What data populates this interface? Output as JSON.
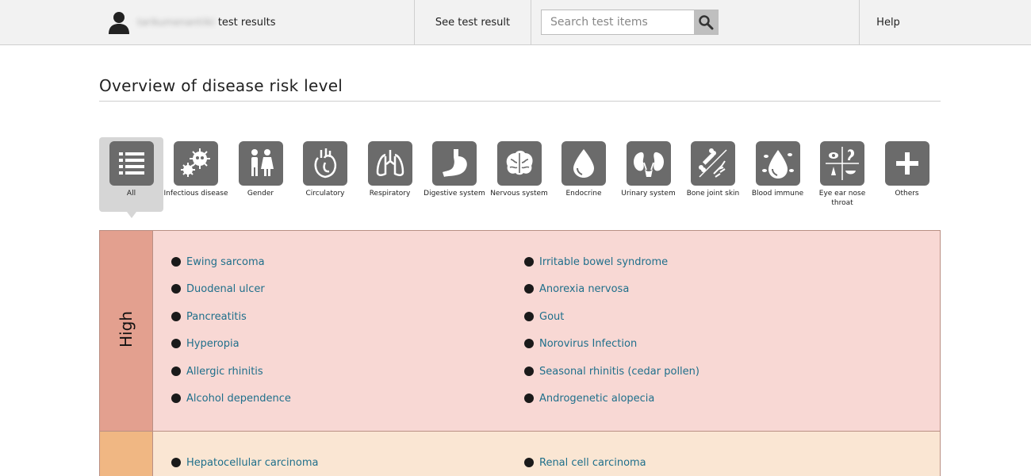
{
  "header": {
    "user_name": "tarikumenantiiki",
    "user_suffix": "test results",
    "see_result": "See test result",
    "search_placeholder": "Search test items",
    "help": "Help"
  },
  "page_title": "Overview of disease risk level",
  "categories": [
    {
      "label": "All",
      "icon": "list-icon",
      "active": true
    },
    {
      "label": "Infectious disease",
      "icon": "virus-icon"
    },
    {
      "label": "Gender",
      "icon": "gender-icon"
    },
    {
      "label": "Circulatory",
      "icon": "heart-icon"
    },
    {
      "label": "Respiratory",
      "icon": "lungs-icon"
    },
    {
      "label": "Digestive system",
      "icon": "stomach-icon"
    },
    {
      "label": "Nervous system",
      "icon": "brain-icon"
    },
    {
      "label": "Endocrine",
      "icon": "drop-icon"
    },
    {
      "label": "Urinary system",
      "icon": "kidney-icon"
    },
    {
      "label": "Bone joint skin",
      "icon": "bone-icon"
    },
    {
      "label": "Blood immune",
      "icon": "blood-drop-icon"
    },
    {
      "label": "Eye ear nose throat",
      "icon": "eye-ear-nose-icon"
    },
    {
      "label": "Others",
      "icon": "plus-icon"
    }
  ],
  "risk_levels": [
    {
      "label": "High",
      "color": "#e3a08f",
      "left": [
        "Ewing sarcoma",
        "Duodenal ulcer",
        "Pancreatitis",
        "Hyperopia",
        "Allergic rhinitis",
        "Alcohol dependence"
      ],
      "right": [
        "Irritable bowel syndrome",
        "Anorexia nervosa",
        "Gout",
        "Norovirus Infection",
        "Seasonal rhinitis (cedar pollen)",
        "Androgenetic alopecia"
      ]
    },
    {
      "label": "",
      "color": "#f0b783",
      "left": [
        "Hepatocellular carcinoma"
      ],
      "right": [
        "Renal cell carcinoma"
      ]
    }
  ],
  "colors": {
    "link": "#1f6f8b",
    "icon_bg": "#6b6b6b",
    "active_tab": "#d6d6d6"
  }
}
